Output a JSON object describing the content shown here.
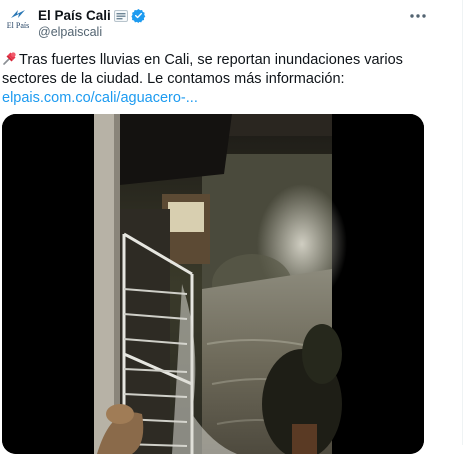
{
  "account": {
    "avatar_icon": "el-pais-logo-icon",
    "avatar_text": "El País",
    "display_name": "El País Cali",
    "affiliate_icon": "organization-badge-icon",
    "verified_icon": "verified-checkmark-icon",
    "handle": "@elpaiscali"
  },
  "menu": {
    "icon": "more-options-icon"
  },
  "tweet": {
    "pin_icon": "pushpin-emoji-icon",
    "text": "Tras fuertes lluvias en Cali, se reportan inundaciones varios sectores de la ciudad. Le contamos más información:",
    "link": "elpais.com.co/cali/aguacero-..."
  },
  "media": {
    "type": "video",
    "description_icon": "flooded-street-video-thumbnail"
  },
  "colors": {
    "link": "#1d9bf0",
    "verified": "#1d9bf0",
    "secondary_text": "#536471",
    "primary_text": "#0f1419"
  }
}
